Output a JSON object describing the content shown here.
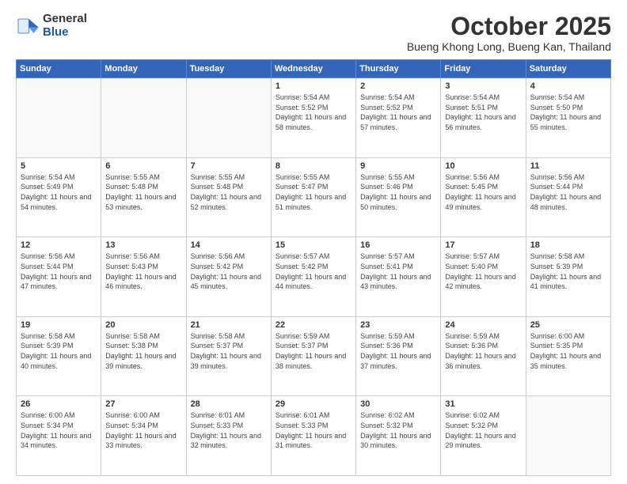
{
  "logo": {
    "general": "General",
    "blue": "Blue"
  },
  "header": {
    "month": "October 2025",
    "location": "Bueng Khong Long, Bueng Kan, Thailand"
  },
  "weekdays": [
    "Sunday",
    "Monday",
    "Tuesday",
    "Wednesday",
    "Thursday",
    "Friday",
    "Saturday"
  ],
  "weeks": [
    [
      {
        "day": "",
        "sunrise": "",
        "sunset": "",
        "daylight": "",
        "empty": true
      },
      {
        "day": "",
        "sunrise": "",
        "sunset": "",
        "daylight": "",
        "empty": true
      },
      {
        "day": "",
        "sunrise": "",
        "sunset": "",
        "daylight": "",
        "empty": true
      },
      {
        "day": "1",
        "sunrise": "5:54 AM",
        "sunset": "5:52 PM",
        "daylight": "11 hours and 58 minutes."
      },
      {
        "day": "2",
        "sunrise": "5:54 AM",
        "sunset": "5:52 PM",
        "daylight": "11 hours and 57 minutes."
      },
      {
        "day": "3",
        "sunrise": "5:54 AM",
        "sunset": "5:51 PM",
        "daylight": "11 hours and 56 minutes."
      },
      {
        "day": "4",
        "sunrise": "5:54 AM",
        "sunset": "5:50 PM",
        "daylight": "11 hours and 55 minutes."
      }
    ],
    [
      {
        "day": "5",
        "sunrise": "5:54 AM",
        "sunset": "5:49 PM",
        "daylight": "11 hours and 54 minutes."
      },
      {
        "day": "6",
        "sunrise": "5:55 AM",
        "sunset": "5:48 PM",
        "daylight": "11 hours and 53 minutes."
      },
      {
        "day": "7",
        "sunrise": "5:55 AM",
        "sunset": "5:48 PM",
        "daylight": "11 hours and 52 minutes."
      },
      {
        "day": "8",
        "sunrise": "5:55 AM",
        "sunset": "5:47 PM",
        "daylight": "11 hours and 51 minutes."
      },
      {
        "day": "9",
        "sunrise": "5:55 AM",
        "sunset": "5:46 PM",
        "daylight": "11 hours and 50 minutes."
      },
      {
        "day": "10",
        "sunrise": "5:56 AM",
        "sunset": "5:45 PM",
        "daylight": "11 hours and 49 minutes."
      },
      {
        "day": "11",
        "sunrise": "5:56 AM",
        "sunset": "5:44 PM",
        "daylight": "11 hours and 48 minutes."
      }
    ],
    [
      {
        "day": "12",
        "sunrise": "5:56 AM",
        "sunset": "5:44 PM",
        "daylight": "11 hours and 47 minutes."
      },
      {
        "day": "13",
        "sunrise": "5:56 AM",
        "sunset": "5:43 PM",
        "daylight": "11 hours and 46 minutes."
      },
      {
        "day": "14",
        "sunrise": "5:56 AM",
        "sunset": "5:42 PM",
        "daylight": "11 hours and 45 minutes."
      },
      {
        "day": "15",
        "sunrise": "5:57 AM",
        "sunset": "5:42 PM",
        "daylight": "11 hours and 44 minutes."
      },
      {
        "day": "16",
        "sunrise": "5:57 AM",
        "sunset": "5:41 PM",
        "daylight": "11 hours and 43 minutes."
      },
      {
        "day": "17",
        "sunrise": "5:57 AM",
        "sunset": "5:40 PM",
        "daylight": "11 hours and 42 minutes."
      },
      {
        "day": "18",
        "sunrise": "5:58 AM",
        "sunset": "5:39 PM",
        "daylight": "11 hours and 41 minutes."
      }
    ],
    [
      {
        "day": "19",
        "sunrise": "5:58 AM",
        "sunset": "5:39 PM",
        "daylight": "11 hours and 40 minutes."
      },
      {
        "day": "20",
        "sunrise": "5:58 AM",
        "sunset": "5:38 PM",
        "daylight": "11 hours and 39 minutes."
      },
      {
        "day": "21",
        "sunrise": "5:58 AM",
        "sunset": "5:37 PM",
        "daylight": "11 hours and 39 minutes."
      },
      {
        "day": "22",
        "sunrise": "5:59 AM",
        "sunset": "5:37 PM",
        "daylight": "11 hours and 38 minutes."
      },
      {
        "day": "23",
        "sunrise": "5:59 AM",
        "sunset": "5:36 PM",
        "daylight": "11 hours and 37 minutes."
      },
      {
        "day": "24",
        "sunrise": "5:59 AM",
        "sunset": "5:36 PM",
        "daylight": "11 hours and 36 minutes."
      },
      {
        "day": "25",
        "sunrise": "6:00 AM",
        "sunset": "5:35 PM",
        "daylight": "11 hours and 35 minutes."
      }
    ],
    [
      {
        "day": "26",
        "sunrise": "6:00 AM",
        "sunset": "5:34 PM",
        "daylight": "11 hours and 34 minutes."
      },
      {
        "day": "27",
        "sunrise": "6:00 AM",
        "sunset": "5:34 PM",
        "daylight": "11 hours and 33 minutes."
      },
      {
        "day": "28",
        "sunrise": "6:01 AM",
        "sunset": "5:33 PM",
        "daylight": "11 hours and 32 minutes."
      },
      {
        "day": "29",
        "sunrise": "6:01 AM",
        "sunset": "5:33 PM",
        "daylight": "11 hours and 31 minutes."
      },
      {
        "day": "30",
        "sunrise": "6:02 AM",
        "sunset": "5:32 PM",
        "daylight": "11 hours and 30 minutes."
      },
      {
        "day": "31",
        "sunrise": "6:02 AM",
        "sunset": "5:32 PM",
        "daylight": "11 hours and 29 minutes."
      },
      {
        "day": "",
        "sunrise": "",
        "sunset": "",
        "daylight": "",
        "empty": true
      }
    ]
  ]
}
